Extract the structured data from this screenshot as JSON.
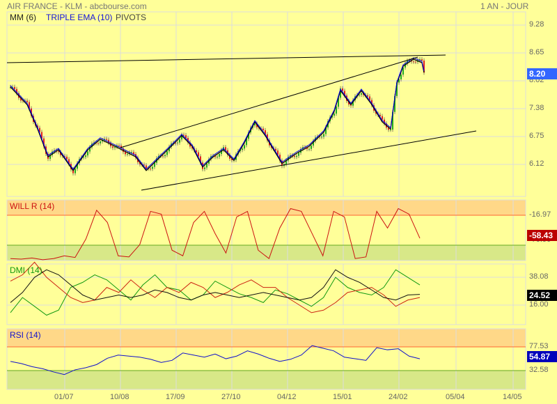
{
  "header": {
    "title": "AIR FRANCE - KLM - abcbourse.com",
    "period": "1 AN - JOUR"
  },
  "legend": {
    "mm": "MM (6)",
    "tema": "TRIPLE EMA (10)",
    "pivots": "PIVOTS"
  },
  "colors": {
    "bg": "#ffff99",
    "up": "#22aa22",
    "down": "#dd2222",
    "tema": "#0000ee",
    "willr": "#cc1111",
    "rsi": "#1111cc",
    "dmi_pos": "#119911",
    "dmi_neg": "#cc2211",
    "adx": "#111111",
    "overbought": "#ffd888",
    "oversold": "#d8e888"
  },
  "chart_data": [
    {
      "type": "candlestick",
      "name": "price",
      "yticks": [
        "9.28",
        "8.65",
        "8.02",
        "7.38",
        "6.75",
        "6.12"
      ],
      "xticks": [
        "01/07",
        "10/08",
        "17/09",
        "27/10",
        "04/12",
        "15/01",
        "24/02",
        "05/04",
        "14/05"
      ],
      "t": [
        0,
        8,
        13,
        18,
        23,
        30,
        37,
        43,
        50,
        60,
        65,
        70,
        77,
        82,
        87,
        92,
        97,
        102,
        107,
        112,
        117,
        122,
        125,
        130,
        137,
        143,
        150,
        155,
        158,
        163,
        168,
        173,
        178,
        182,
        185,
        188,
        193,
        197,
        198
      ],
      "close": [
        7.87,
        7.47,
        6.92,
        6.29,
        6.45,
        5.98,
        6.45,
        6.69,
        6.53,
        6.29,
        5.98,
        6.21,
        6.53,
        6.77,
        6.53,
        6.06,
        6.29,
        6.45,
        6.21,
        6.61,
        7.08,
        6.77,
        6.53,
        6.14,
        6.37,
        6.53,
        6.85,
        7.32,
        7.79,
        7.47,
        7.79,
        7.47,
        7.08,
        6.92,
        7.95,
        8.34,
        8.5,
        8.42,
        8.2
      ],
      "last": "8.20"
    },
    {
      "type": "line",
      "name": "WILL R (14)",
      "yticks": [
        "-16.97",
        "-70.90"
      ],
      "last": "-58.43",
      "values": [
        -95,
        -96,
        -94,
        -97,
        -95,
        -90,
        -93,
        -60,
        -8,
        -30,
        -90,
        -92,
        -70,
        -10,
        -15,
        -80,
        -90,
        -30,
        -10,
        -50,
        -85,
        -20,
        -10,
        -80,
        -95,
        -40,
        -5,
        -10,
        -50,
        -90,
        -10,
        -20,
        -95,
        -92,
        -10,
        -40,
        -5,
        -15,
        -58.43
      ]
    },
    {
      "type": "line",
      "name": "DMI (14)",
      "yticks": [
        "38.08",
        "16.00"
      ],
      "last": "24.52",
      "series": [
        {
          "name": "+DI",
          "values": [
            10,
            22,
            15,
            8,
            12,
            30,
            34,
            40,
            36,
            28,
            20,
            32,
            40,
            30,
            28,
            20,
            24,
            35,
            30,
            25,
            22,
            18,
            28,
            25,
            20,
            15,
            22,
            38,
            30,
            26,
            24,
            30,
            44,
            38,
            32
          ]
        },
        {
          "name": "-DI",
          "values": [
            35,
            40,
            50,
            38,
            30,
            22,
            18,
            20,
            30,
            26,
            36,
            28,
            22,
            30,
            26,
            34,
            30,
            22,
            26,
            32,
            36,
            30,
            30,
            22,
            16,
            10,
            12,
            18,
            26,
            28,
            30,
            24,
            15,
            20,
            22
          ]
        },
        {
          "name": "ADX",
          "values": [
            18,
            26,
            38,
            44,
            40,
            32,
            24,
            20,
            22,
            24,
            22,
            24,
            28,
            26,
            22,
            20,
            24,
            26,
            24,
            22,
            24,
            26,
            24,
            22,
            20,
            22,
            30,
            44,
            38,
            34,
            28,
            22,
            20,
            24,
            24.52
          ]
        }
      ]
    },
    {
      "type": "line",
      "name": "RSI (14)",
      "yticks": [
        "77.53",
        "32.58"
      ],
      "last": "54.87",
      "values": [
        50,
        46,
        40,
        36,
        30,
        25,
        34,
        38,
        44,
        56,
        62,
        60,
        58,
        54,
        48,
        52,
        66,
        62,
        58,
        64,
        55,
        60,
        70,
        64,
        56,
        50,
        54,
        62,
        80,
        75,
        70,
        58,
        55,
        52,
        76,
        72,
        74,
        60,
        54.87
      ]
    }
  ]
}
